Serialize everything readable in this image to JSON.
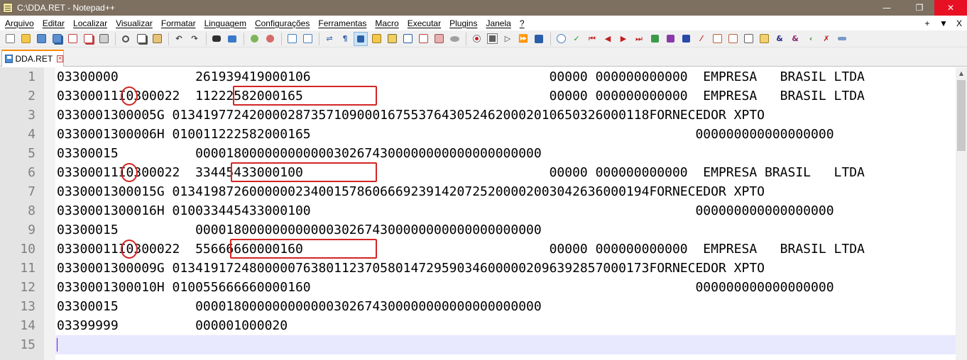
{
  "window": {
    "title": "C:\\DDA.RET - Notepad++",
    "minimize_glyph": "—",
    "maximize_glyph": "❐",
    "close_glyph": "✕",
    "app_icon": "notepad-icon"
  },
  "menu": {
    "items": [
      "Arquivo",
      "Editar",
      "Localizar",
      "Visualizar",
      "Formatar",
      "Linguagem",
      "Configurações",
      "Ferramentas",
      "Macro",
      "Executar",
      "Plugins",
      "Janela",
      "?"
    ],
    "right_plus": "+",
    "right_down": "▼",
    "right_close": "X"
  },
  "toolbar": {
    "icons": [
      "new-file-icon",
      "open-file-icon",
      "save-icon",
      "save-all-icon",
      "close-icon",
      "close-all-icon",
      "print-icon",
      "cut-icon",
      "copy-icon",
      "paste-icon",
      "undo-icon",
      "redo-icon",
      "find-icon",
      "replace-icon",
      "zoom-in-icon",
      "zoom-out-icon",
      "sync-vertical-icon",
      "sync-horizontal-icon",
      "word-wrap-icon",
      "show-all-chars-icon",
      "indent-guide-icon",
      "language-icon",
      "doc-map-icon",
      "function-list-icon",
      "folder-workspace-icon",
      "monitor-icon",
      "record-macro-icon",
      "stop-macro-icon",
      "play-macro-icon",
      "run-macro-multiple-icon",
      "save-macro-icon"
    ]
  },
  "tab": {
    "label": "DDA.RET",
    "close_glyph": "✕"
  },
  "editor": {
    "lines": [
      {
        "num": "1",
        "text": "03300000          261939419000106                               00000 000000000000  EMPRESA   BRASIL LTDA"
      },
      {
        "num": "2",
        "text": "03300011I0300022  11222582000165                                00000 000000000000  EMPRESA   BRASIL LTDA"
      },
      {
        "num": "3",
        "text": "0330001300005G 01341977242000028735710900016755376430524620002010650326000118FORNECEDOR XPTO"
      },
      {
        "num": "4",
        "text": "0330001300006H 010011222582000165                                                  000000000000000000"
      },
      {
        "num": "5",
        "text": "03300015          000018000000000000302674300000000000000000000"
      },
      {
        "num": "6",
        "text": "03300011I0300022  33445433000100                                00000 000000000000  EMPRESA BRASIL   LTDA"
      },
      {
        "num": "7",
        "text": "0330001300015G 01341987260000002340015786066692391420725200002003042636000194FORNECEDOR XPTO"
      },
      {
        "num": "8",
        "text": "0330001300016H 010033445433000100                                                  000000000000000000"
      },
      {
        "num": "9",
        "text": "03300015          000018000000000000302674300000000000000000000"
      },
      {
        "num": "10",
        "text": "03300011I0300022  55666660000160                                00000 000000000000  EMPRESA   BRASIL LTDA"
      },
      {
        "num": "11",
        "text": "0330001300009G 01341917248000007638011237058014729590346000002096392857000173FORNECEDOR XPTO"
      },
      {
        "num": "12",
        "text": "0330001300010H 010055666660000160                                                  000000000000000000"
      },
      {
        "num": "13",
        "text": "03300015          000018000000000000302674300000000000000000000"
      },
      {
        "num": "14",
        "text": "03399999          000001000020"
      },
      {
        "num": "15",
        "text": ""
      }
    ]
  },
  "colors": {
    "titlebar": "#7d7061",
    "annotation": "#d42525",
    "active_tab_accent": "#fa8a00",
    "current_line": "#e8e8ff"
  }
}
